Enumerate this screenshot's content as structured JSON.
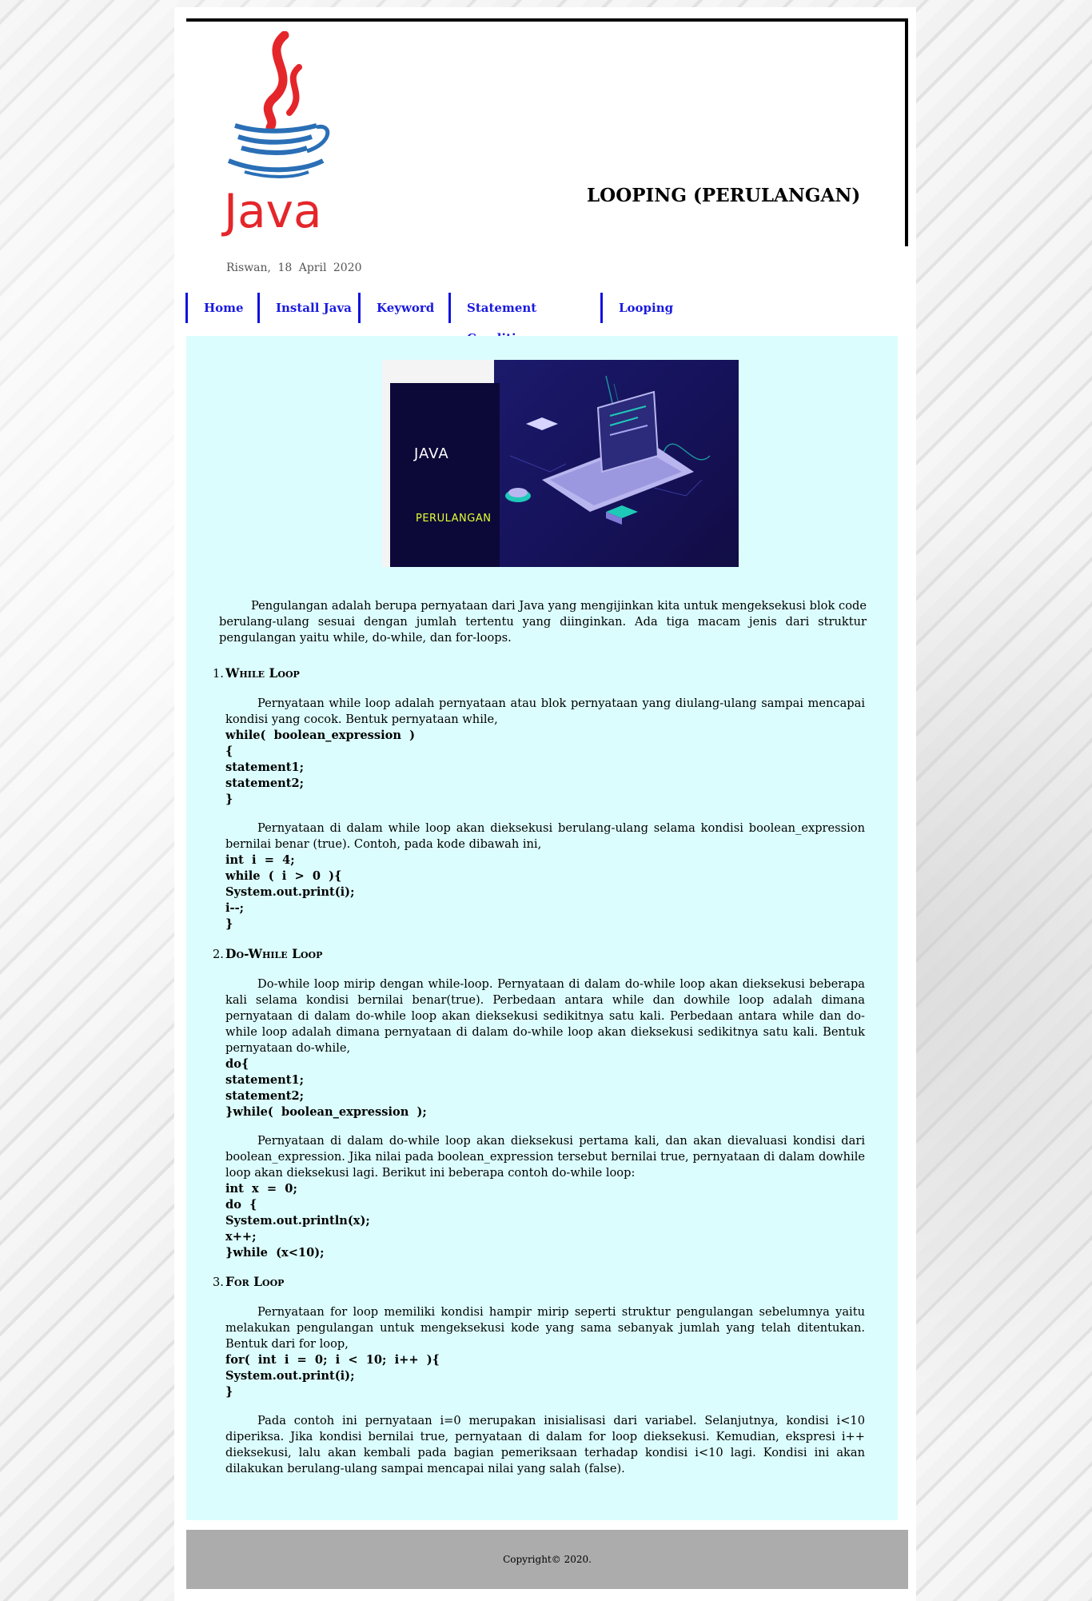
{
  "header": {
    "title": "LOOPING (PERULANGAN)",
    "logo_text": "Java",
    "byline": "Riswan,  18  April  2020"
  },
  "nav": {
    "items": [
      {
        "label": "Home"
      },
      {
        "label": "Install Java"
      },
      {
        "label": "Keyword"
      },
      {
        "label": "Statement Condition"
      },
      {
        "label": "Looping"
      }
    ]
  },
  "hero": {
    "title": "JAVA",
    "subtitle": "PERULANGAN"
  },
  "intro": "Pengulangan adalah berupa pernyataan dari Java yang mengijinkan kita untuk mengeksekusi blok code berulang-ulang sesuai dengan jumlah tertentu yang diinginkan. Ada tiga macam jenis dari struktur pengulangan yaitu while, do-while, dan for-loops.",
  "sections": [
    {
      "number": "1.",
      "heading": "While Loop",
      "para1": "Pernyataan while loop adalah pernyataan atau blok pernyataan yang diulang-ulang sampai mencapai kondisi yang cocok. Bentuk pernyataan while,",
      "code1": "while(  boolean_expression  )\n{\nstatement1;\nstatement2;\n}",
      "para2": "Pernyataan di dalam while loop akan dieksekusi berulang-ulang selama kondisi boolean_expression bernilai benar (true). Contoh, pada kode dibawah ini,",
      "code2": "int  i  =  4;\nwhile  (  i  >  0  ){\nSystem.out.print(i);\ni--;\n}"
    },
    {
      "number": "2.",
      "heading": "Do-While Loop",
      "para1": "Do-while loop mirip dengan while-loop. Pernyataan di dalam do-while loop akan dieksekusi beberapa kali selama kondisi bernilai benar(true). Perbedaan antara while dan dowhile loop adalah dimana pernyataan di dalam do-while loop akan dieksekusi sedikitnya satu kali. Perbedaan antara while dan do-while loop adalah dimana pernyataan di dalam do-while loop akan dieksekusi sedikitnya satu kali. Bentuk pernyataan do-while,",
      "code1": "do{\nstatement1;\nstatement2;\n}while(  boolean_expression  );",
      "para2": "Pernyataan di dalam do-while loop akan dieksekusi pertama kali, dan akan dievaluasi kondisi dari boolean_expression. Jika nilai pada boolean_expression tersebut bernilai true, pernyataan di dalam dowhile loop akan dieksekusi lagi. Berikut ini beberapa contoh do-while loop:",
      "code2": "int  x  =  0;\ndo  {\nSystem.out.println(x);\nx++;\n}while  (x<10);"
    },
    {
      "number": "3.",
      "heading": "For Loop",
      "para1": "Pernyataan for loop memiliki kondisi hampir mirip seperti struktur pengulangan sebelumnya yaitu melakukan pengulangan untuk mengeksekusi kode yang sama sebanyak jumlah yang telah ditentukan. Bentuk dari for loop,",
      "code1": "for(  int  i  =  0;  i  <  10;  i++  ){\nSystem.out.print(i);\n}",
      "para2": "Pada contoh ini pernyataan i=0 merupakan inisialisasi dari variabel. Selanjutnya, kondisi i<10 diperiksa. Jika kondisi bernilai true, pernyataan di dalam for loop dieksekusi. Kemudian, ekspresi i++ dieksekusi, lalu akan kembali pada bagian pemeriksaan terhadap kondisi i<10 lagi. Kondisi ini akan dilakukan berulang-ulang sampai mencapai nilai yang salah (false).",
      "code2": ""
    }
  ],
  "footer": {
    "text": "Copyright©  2020."
  },
  "colors": {
    "nav_link": "#1a1ae0",
    "content_bg": "#dcfdfd",
    "footer_bg": "#acacac"
  }
}
